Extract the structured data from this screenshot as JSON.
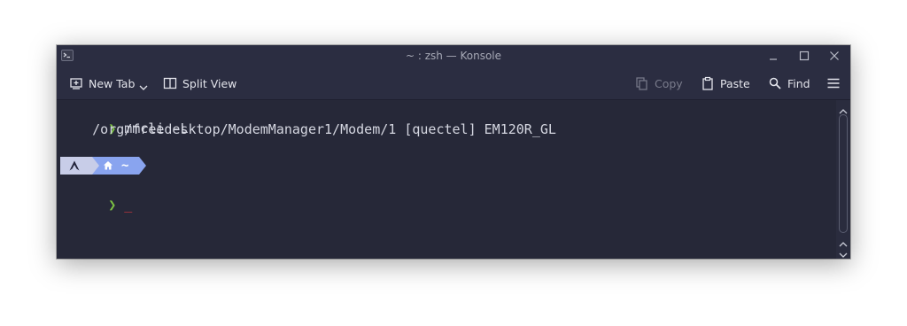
{
  "window": {
    "title": "~ : zsh — Konsole"
  },
  "toolbar": {
    "new_tab_label": "New Tab",
    "split_view_label": "Split View",
    "copy_label": "Copy",
    "paste_label": "Paste",
    "find_label": "Find"
  },
  "terminal": {
    "command": "mmcli -L",
    "output": "    /org/freedesktop/ModemManager1/Modem/1 [quectel] EM120R_GL",
    "prompt_char": "❯",
    "cursor": "_",
    "prompt_dir": "~"
  },
  "colors": {
    "terminal_bg": "#262838",
    "prompt_chevron": "#7bc043",
    "segment_os": "#c8cde8",
    "segment_dir": "#89a4ef",
    "cursor": "#e0383e"
  }
}
